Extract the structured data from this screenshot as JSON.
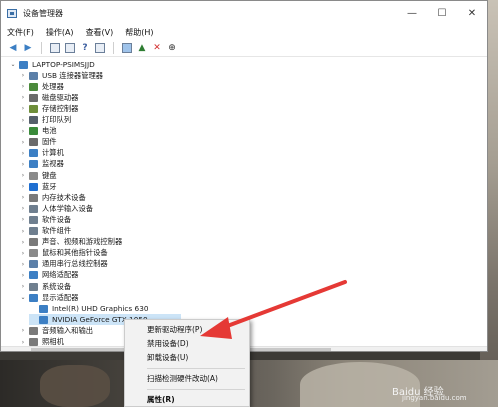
{
  "window": {
    "title": "设备管理器",
    "controls": {
      "minimize": "—",
      "maximize": "☐",
      "close": "✕"
    }
  },
  "menu": [
    "文件(F)",
    "操作(A)",
    "查看(V)",
    "帮助(H)"
  ],
  "toolbar_icons": [
    "back-icon",
    "forward-icon",
    "properties-icon",
    "list-icon",
    "help-icon",
    "view-icon",
    "monitor-icon",
    "update-driver-icon",
    "remove-icon",
    "download-icon"
  ],
  "tree": {
    "root": "LAPTOP-PSIMSJJD",
    "items": [
      {
        "label": "USB 连接器管理器",
        "color": "#5b7fa8"
      },
      {
        "label": "处理器",
        "color": "#4b8a3c"
      },
      {
        "label": "磁盘驱动器",
        "color": "#6b6b6b"
      },
      {
        "label": "存储控制器",
        "color": "#6e8e3a"
      },
      {
        "label": "打印队列",
        "color": "#555f6b"
      },
      {
        "label": "电池",
        "color": "#3a8a3a"
      },
      {
        "label": "固件",
        "color": "#6b6b6b"
      },
      {
        "label": "计算机",
        "color": "#3c7fc4"
      },
      {
        "label": "监视器",
        "color": "#3c7fc4"
      },
      {
        "label": "键盘",
        "color": "#8a8a8a"
      },
      {
        "label": "蓝牙",
        "color": "#1f6fd1"
      },
      {
        "label": "内存技术设备",
        "color": "#7a7a7a"
      },
      {
        "label": "人体学输入设备",
        "color": "#6f7f8f"
      },
      {
        "label": "软件设备",
        "color": "#6f7f8f"
      },
      {
        "label": "软件组件",
        "color": "#6f7f8f"
      },
      {
        "label": "声音、视频和游戏控制器",
        "color": "#7a7a7a"
      },
      {
        "label": "鼠标和其他指针设备",
        "color": "#8a8a8a"
      },
      {
        "label": "通用串行总线控制器",
        "color": "#5b7fa8"
      },
      {
        "label": "网络适配器",
        "color": "#3c7fc4"
      },
      {
        "label": "系统设备",
        "color": "#6f7f8f"
      },
      {
        "label": "显示适配器",
        "color": "#3c7fc4"
      }
    ],
    "display_children": [
      "Intel(R) UHD Graphics 630",
      "NVIDIA GeForce GTX 1050"
    ],
    "after": [
      {
        "label": "音频输入和输出",
        "color": "#7a7a7a"
      },
      {
        "label": "照相机",
        "color": "#7a7a7a"
      }
    ]
  },
  "context_menu": {
    "items": [
      "更新驱动程序(P)",
      "禁用设备(D)",
      "卸载设备(U)",
      "扫描检测硬件改动(A)",
      "属性(R)"
    ]
  },
  "watermark": {
    "main": "Baidu 经验",
    "sub": "jingyan.baidu.com"
  },
  "colors": {
    "selection": "#cce4f7",
    "arrow": "#e53935",
    "menu_bg": "#f2f2f2"
  }
}
